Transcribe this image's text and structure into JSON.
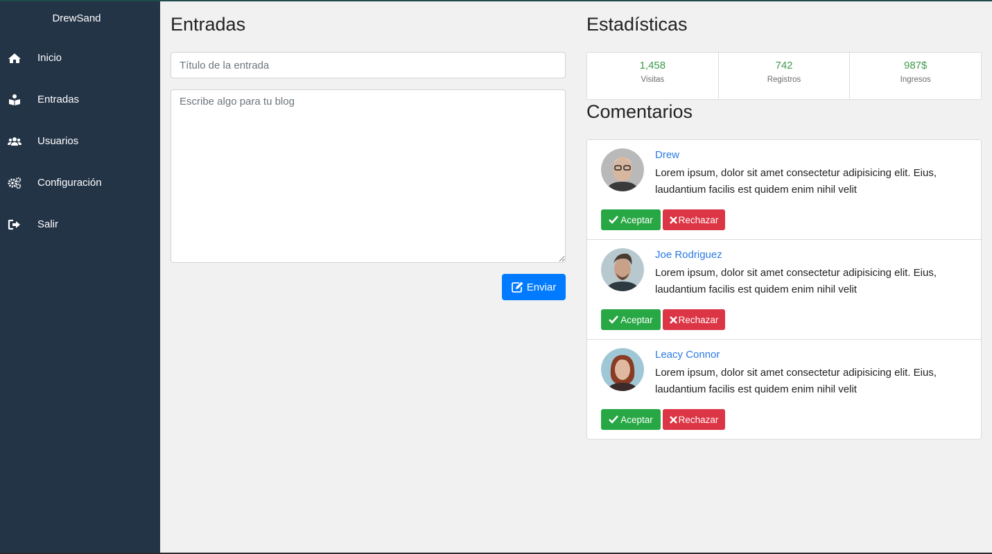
{
  "sidebar": {
    "brand": "DrewSand",
    "items": [
      {
        "label": "Inicio",
        "icon": "home-icon"
      },
      {
        "label": "Entradas",
        "icon": "reader-icon"
      },
      {
        "label": "Usuarios",
        "icon": "users-icon"
      },
      {
        "label": "Configuración",
        "icon": "cogs-icon"
      },
      {
        "label": "Salir",
        "icon": "sign-out-icon"
      }
    ]
  },
  "entries": {
    "title": "Entradas",
    "title_placeholder": "Título de la entrada",
    "body_placeholder": "Escribe algo para tu blog",
    "send_label": "Enviar"
  },
  "stats": {
    "title": "Estadísticas",
    "items": [
      {
        "value": "1,458",
        "label": "Visitas"
      },
      {
        "value": "742",
        "label": "Registros"
      },
      {
        "value": "987$",
        "label": "Ingresos"
      }
    ]
  },
  "comments": {
    "title": "Comentarios",
    "accept_label": "Aceptar",
    "reject_label": "Rechazar",
    "items": [
      {
        "name": "Drew",
        "text": "Lorem ipsum, dolor sit amet consectetur adipisicing elit. Eius, laudantium facilis est quidem enim nihil velit"
      },
      {
        "name": "Joe Rodriguez",
        "text": "Lorem ipsum, dolor sit amet consectetur adipisicing elit. Eius, laudantium facilis est quidem enim nihil velit"
      },
      {
        "name": "Leacy Connor",
        "text": "Lorem ipsum, dolor sit amet consectetur adipisicing elit. Eius, laudantium facilis est quidem enim nihil velit"
      }
    ]
  },
  "colors": {
    "sidebar": "#243447",
    "primary": "#007bff",
    "success": "#28a745",
    "danger": "#dc3545",
    "stat_value": "#3d9a4a",
    "link": "#2a7ae2"
  }
}
